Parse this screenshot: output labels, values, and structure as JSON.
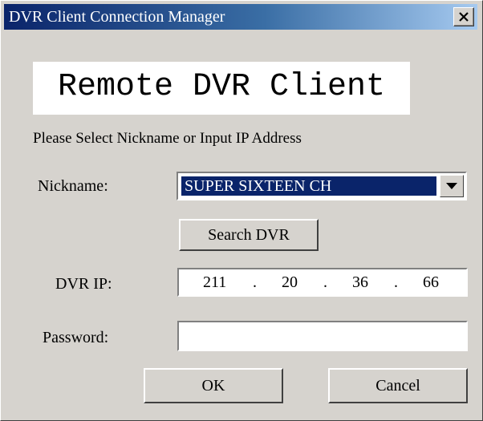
{
  "window": {
    "title": "DVR Client Connection Manager",
    "close_label": "×"
  },
  "banner": {
    "text": "Remote DVR Client"
  },
  "instruction": "Please Select Nickname or Input IP Address",
  "nickname": {
    "label": "Nickname:",
    "selected": "SUPER SIXTEEN CH"
  },
  "search_button": {
    "label": "Search DVR"
  },
  "dvr_ip": {
    "label": "DVR IP:",
    "octets": [
      "211",
      "20",
      "36",
      "66"
    ],
    "separator": "."
  },
  "password": {
    "label": "Password:",
    "value": ""
  },
  "buttons": {
    "ok": "OK",
    "cancel": "Cancel"
  },
  "colors": {
    "titlebar_start": "#0a246a",
    "titlebar_end": "#a6caf0",
    "dialog_face": "#d6d3ce",
    "selection": "#0a246a"
  }
}
